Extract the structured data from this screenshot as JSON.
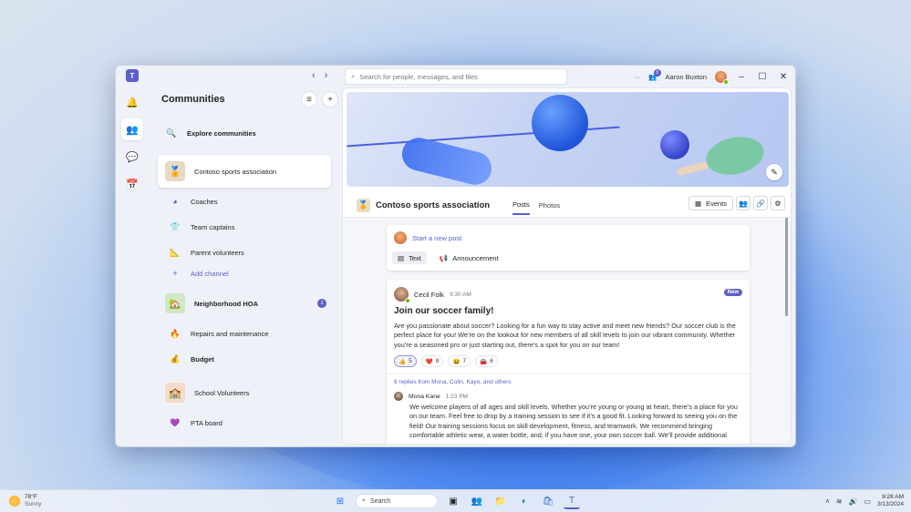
{
  "window": {
    "search_placeholder": "Search for people, messages, and files",
    "user_name": "Aaron Buxton",
    "notification_count": "3",
    "more_label": "···"
  },
  "left_pane": {
    "title": "Communities",
    "explore_label": "Explore communities",
    "communities": [
      {
        "name": "Contoso sports association",
        "icon": "medal-icon",
        "channels": [
          {
            "label": "Coaches",
            "icon": "pie-icon"
          },
          {
            "label": "Team captains",
            "icon": "shirt-icon"
          },
          {
            "label": "Parent volunteers",
            "icon": "ruler-icon"
          }
        ],
        "add_channel_label": "Add channel"
      },
      {
        "name": "Neighborhood HOA",
        "icon": "house-icon",
        "unread": "1",
        "channels": [
          {
            "label": "Repairs and maintenance",
            "icon": "flame-icon"
          },
          {
            "label": "Budget",
            "icon": "moneybag-icon",
            "bold": true
          }
        ]
      },
      {
        "name": "School Volunteers",
        "icon": "school-icon",
        "channels": [
          {
            "label": "PTA board",
            "icon": "heart-icon"
          }
        ]
      }
    ]
  },
  "main": {
    "community_title": "Contoso sports association",
    "tabs": [
      "Posts",
      "Photos"
    ],
    "active_tab": "Posts",
    "events_label": "Events",
    "composer": {
      "start_label": "Start a new post",
      "options": [
        "Text",
        "Announcement"
      ]
    },
    "post": {
      "author": "Cecil Folk",
      "time": "9:30 AM",
      "badge": "New",
      "title": "Join our soccer family!",
      "body": "Are you passionate about soccer? Looking for a fun way to stay active and meet new friends? Our soccer club is the perfect place for you! We’re on the lookout for new members of all skill levels to join our vibrant community. Whether you’re a seasoned pro or just starting out, there’s a spot for you on our team!",
      "reactions": [
        {
          "emoji": "👍",
          "count": "5"
        },
        {
          "emoji": "❤️",
          "count": "8"
        },
        {
          "emoji": "😆",
          "count": "7"
        },
        {
          "emoji": "🚘",
          "count": "6"
        }
      ],
      "replies_link": "8 replies from Mona, Colin, Kayo, and others",
      "reply": {
        "author": "Mona Kane",
        "time": "1:23 PM",
        "body": "We welcome players of all ages and skill levels. Whether you’re young or young at heart, there’s a place for you on our team. Feel free to drop by a training session to see if it’s a good fit. Looking forward to seeing you on the field! Our training sessions focus on skill development, fitness, and teamwork. We recommend bringing comfortable athletic wear, a water bottle, and, if you have one, your own soccer ball. We’ll provide additional"
      }
    }
  },
  "taskbar": {
    "temperature": "78°F",
    "condition": "Sunny",
    "search_label": "Search",
    "time": "9:28 AM",
    "date": "3/13/2024"
  },
  "colors": {
    "accent": "#5b5fc7"
  }
}
